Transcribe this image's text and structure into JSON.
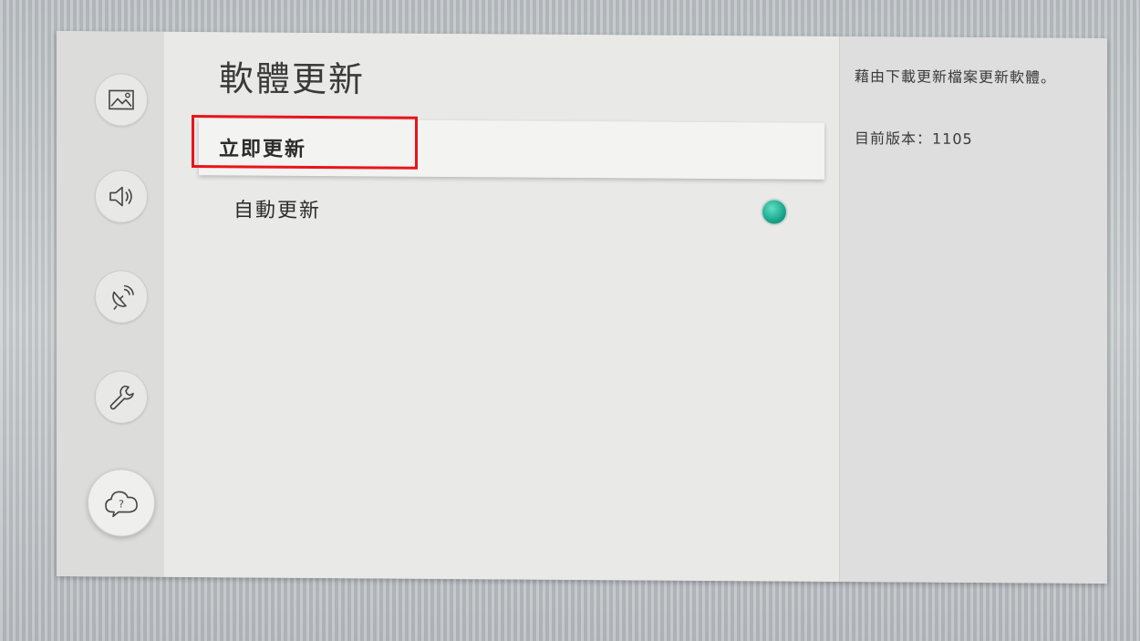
{
  "page": {
    "title": "軟體更新"
  },
  "sidebar": {
    "items": [
      {
        "icon": "picture-icon"
      },
      {
        "icon": "sound-icon"
      },
      {
        "icon": "broadcast-icon"
      },
      {
        "icon": "wrench-icon"
      },
      {
        "icon": "support-cloud-icon"
      }
    ]
  },
  "menu": {
    "update_now": "立即更新",
    "auto_update": "自動更新",
    "auto_update_state": "on"
  },
  "info": {
    "description": "藉由下載更新檔案更新軟體。",
    "version": "目前版本：1105"
  },
  "colors": {
    "highlight": "#e8141b",
    "toggle_on": "#1aa58a"
  }
}
